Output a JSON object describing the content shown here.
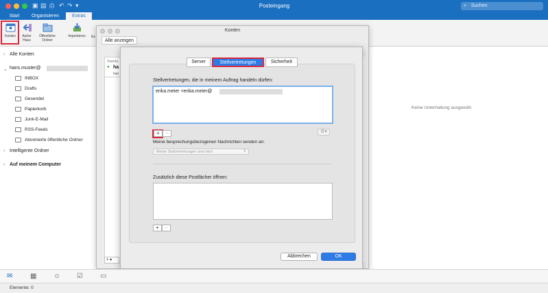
{
  "window": {
    "title": "Posteingang",
    "search_placeholder": "Suchen"
  },
  "ribbon_tabs": [
    {
      "label": "Start"
    },
    {
      "label": "Organisieren"
    },
    {
      "label": "Extras"
    }
  ],
  "ribbon_buttons": {
    "konten": "Konten",
    "ausser_haus_1": "Außer",
    "ausser_haus_2": "Haus",
    "oeffentliche_1": "Öffentliche",
    "oeffentliche_2": "Ordner",
    "importieren": "Importieren",
    "export_partial": "Ex"
  },
  "sidebar": {
    "alle_konten": "Alle Konten",
    "account": "hans.muster@",
    "folders": [
      "INBOX",
      "Drafts",
      "Gesendet",
      "Papierkorb",
      "Junk-E-Mail",
      "RSS-Feeds",
      "Abonnierte öffentliche Ordner"
    ],
    "intelligente_ordner": "Intelligente Ordner",
    "auf_meinem_computer": "Auf meinem Computer"
  },
  "reading_pane": {
    "empty_text": "Keine Unterhaltung ausgewäh"
  },
  "status": {
    "elements": "Elemente: 0"
  },
  "konten_window": {
    "title": "Konten",
    "alle_anzeigen": "Alle anzeigen",
    "left_label_1": "Standa",
    "left_label_2": "ha",
    "left_label_3": "han"
  },
  "sheet": {
    "tabs": [
      {
        "label": "Server"
      },
      {
        "label": "Stellvertretungen"
      },
      {
        "label": "Sicherheit"
      }
    ],
    "delegates_label": "Stellvertretungen, die in meinem Auftrag handeln dürfen:",
    "delegate_entry": "erika.meier <erika.meier@",
    "plus": "+",
    "minus": "−",
    "gear": "⚙",
    "meeting_label": "Meine besprechungsbezogenen Nachrichten senden an:",
    "meeting_select": "Meine Stellvertretungen und mich",
    "mailbox_label": "Zusätzlich diese Postfächer öffnen:",
    "cancel": "Abbrechen",
    "ok": "OK"
  }
}
